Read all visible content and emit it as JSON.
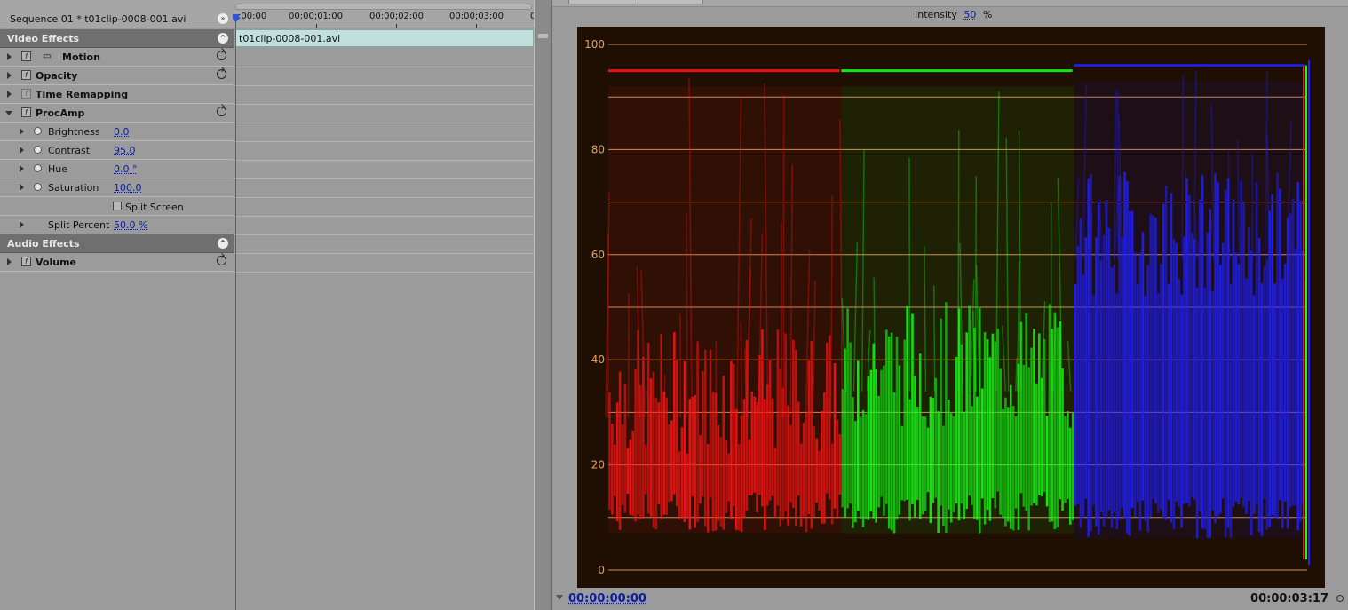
{
  "sequence": {
    "title": "Sequence 01 * t01clip-0008-001.avi"
  },
  "ruler": {
    "ticks": [
      ":00:00",
      "00:00;01:00",
      "00:00;02:00",
      "00:00;03:00",
      "0"
    ]
  },
  "clip": {
    "name": "t01clip-0008-001.avi"
  },
  "video_effects": {
    "header": "Video Effects",
    "motion": "Motion",
    "opacity": "Opacity",
    "time_remapping": "Time Remapping",
    "procamp": {
      "label": "ProcAmp",
      "brightness": {
        "label": "Brightness",
        "value": "0.0"
      },
      "contrast": {
        "label": "Contrast",
        "value": "95.0"
      },
      "hue": {
        "label": "Hue",
        "value": "0.0 °"
      },
      "saturation": {
        "label": "Saturation",
        "value": "100.0"
      },
      "split_screen": {
        "label": "Split Screen",
        "checked": false
      },
      "split_percent": {
        "label": "Split Percent",
        "value": "50.0 %"
      }
    }
  },
  "audio_effects": {
    "header": "Audio Effects",
    "volume": "Volume"
  },
  "monitor": {
    "intensity_label": "Intensity",
    "intensity_value": "50",
    "intensity_unit": "%",
    "timecode_current": "00:00:00:00",
    "timecode_duration": "00:00:03:17"
  },
  "chart_data": {
    "type": "waveform-rgb-parade",
    "ylim": [
      0,
      100
    ],
    "ytick_labels": [
      "0",
      "20",
      "40",
      "60",
      "80",
      "100"
    ],
    "gridlines": [
      0,
      10,
      20,
      30,
      40,
      50,
      60,
      70,
      80,
      90,
      100
    ],
    "grid": true,
    "series": [
      {
        "color": "#ff1414",
        "plateau": 34,
        "floor": 7,
        "ceiling": 95
      },
      {
        "color": "#14ff14",
        "plateau": 39,
        "floor": 7,
        "ceiling": 95
      },
      {
        "color": "#1f1fff",
        "plateau": 64,
        "floor": 6,
        "ceiling": 96
      }
    ],
    "colors": {
      "background": "#1f0f03",
      "gridline": "#f0a66a",
      "tick_label": "#e0a060"
    }
  }
}
